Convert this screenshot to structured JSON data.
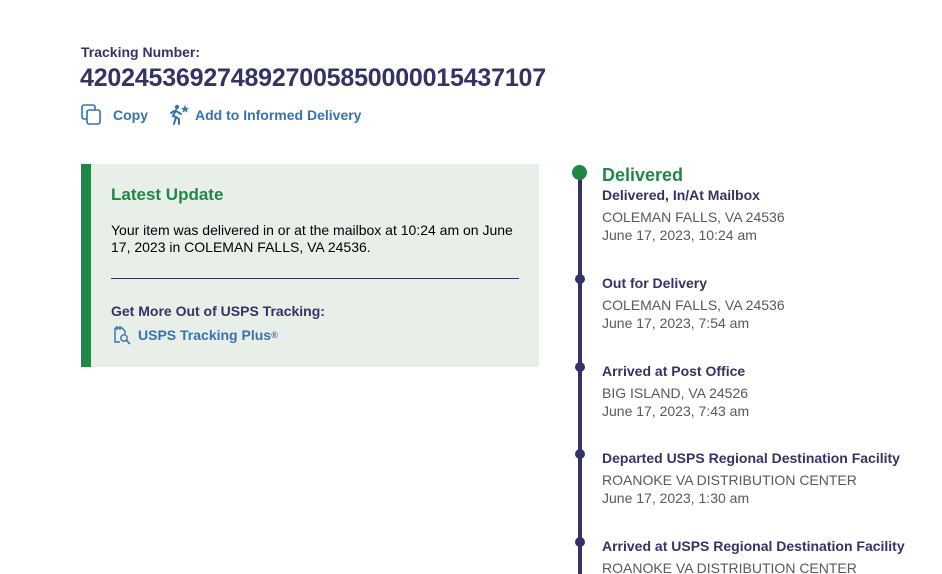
{
  "tracking": {
    "label": "Tracking Number:",
    "number": "4202453692748927005850000015437107"
  },
  "actions": {
    "copy_label": "Copy",
    "informed_label": "Add to Informed Delivery"
  },
  "latest_update": {
    "title": "Latest Update",
    "text": "Your item was delivered in or at the mailbox at 10:24 am on June 17, 2023 in COLEMAN FALLS, VA 24536.",
    "more_title": "Get More Out of USPS Tracking:",
    "plus_label": "USPS Tracking Plus",
    "plus_reg": "®"
  },
  "timeline": {
    "status": "Delivered",
    "events": [
      {
        "title": "Delivered, In/At Mailbox",
        "location": "COLEMAN FALLS, VA 24536",
        "time": "June 17, 2023, 10:24 am"
      },
      {
        "title": "Out for Delivery",
        "location": "COLEMAN FALLS, VA 24536",
        "time": "June 17, 2023, 7:54 am"
      },
      {
        "title": "Arrived at Post Office",
        "location": "BIG ISLAND, VA 24526",
        "time": "June 17, 2023, 7:43 am"
      },
      {
        "title": "Departed USPS Regional Destination Facility",
        "location": "ROANOKE VA DISTRIBUTION CENTER",
        "time": "June 17, 2023, 1:30 am"
      },
      {
        "title": "Arrived at USPS Regional Destination Facility",
        "location": "ROANOKE VA DISTRIBUTION CENTER",
        "time": ""
      }
    ]
  },
  "colors": {
    "navy": "#333366",
    "green": "#218748",
    "link": "#3573b1",
    "panel": "#e8efe9"
  },
  "icons": {
    "copy": "copy-icon",
    "informed": "informed-delivery-icon",
    "plus": "tracking-plus-icon"
  }
}
